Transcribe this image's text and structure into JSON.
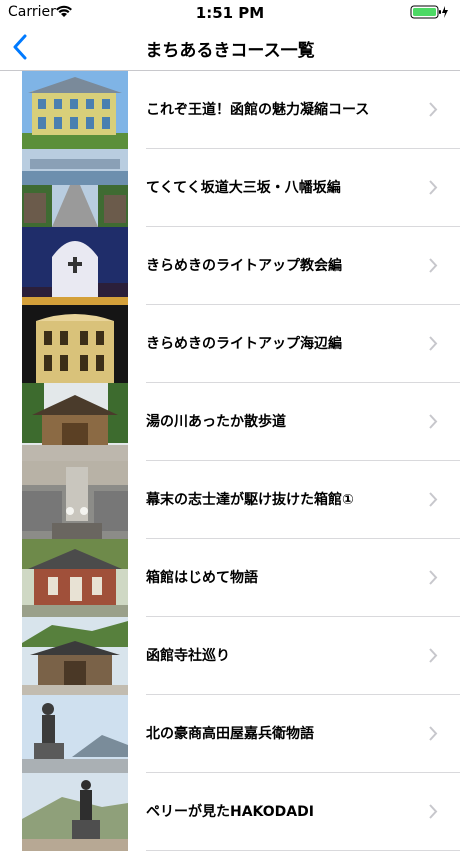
{
  "status": {
    "carrier": "Carrier",
    "time": "1:51 PM"
  },
  "nav": {
    "title": "まちあるきコース一覧",
    "back_icon": "chevron-left-icon"
  },
  "accent": "#007aff",
  "courses": [
    {
      "label": "これぞ王道！函館の魅力凝縮コース"
    },
    {
      "label": "てくてく坂道大三坂・八幡坂編"
    },
    {
      "label": "きらめきのライトアップ教会編"
    },
    {
      "label": "きらめきのライトアップ海辺編"
    },
    {
      "label": "湯の川あったか散歩道"
    },
    {
      "label": "幕末の志士達が駆け抜けた箱館①"
    },
    {
      "label": "箱館はじめて物語"
    },
    {
      "label": "函館寺社巡り"
    },
    {
      "label": "北の豪商高田屋嘉兵衛物語"
    },
    {
      "label": "ペリーが見たHAKODADI"
    }
  ]
}
